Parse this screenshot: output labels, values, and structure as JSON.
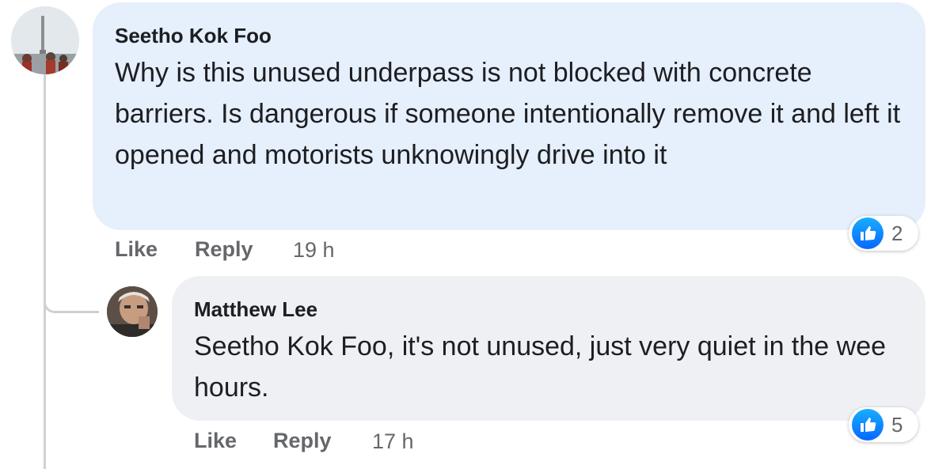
{
  "comments": [
    {
      "author": "Seetho Kok Foo",
      "text": "Why is this unused underpass is not blocked with concrete barriers. Is dangerous if someone intentionally remove it and left it opened and motorists unknowingly drive into it",
      "like_label": "Like",
      "reply_label": "Reply",
      "time": "19 h",
      "reaction_icon": "thumbs-up-icon",
      "reaction_count": "2",
      "reply": {
        "author": "Matthew Lee",
        "mention": "Seetho Kok Foo",
        "text": ", it's not unused, just very quiet in the wee hours.",
        "like_label": "Like",
        "reply_label": "Reply",
        "time": "17 h",
        "reaction_icon": "thumbs-up-icon",
        "reaction_count": "5"
      }
    }
  ],
  "colors": {
    "accent": "#0866ff",
    "bubble_primary": "#e6effc",
    "bubble_reply": "#eef0f3",
    "text": "#1c1e21",
    "muted": "#65676b"
  }
}
